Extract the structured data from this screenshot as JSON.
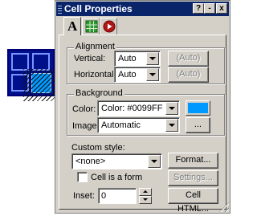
{
  "window": {
    "title": "Cell Properties",
    "help_label": "?",
    "minimize_label": "-",
    "close_label": "x"
  },
  "tabs": [
    {
      "icon": "text-format-icon",
      "glyph": "A"
    },
    {
      "icon": "table-cell-icon"
    },
    {
      "icon": "media-play-icon"
    }
  ],
  "alignment": {
    "group_label": "Alignment",
    "vertical": {
      "label": "Vertical:",
      "value": "Auto",
      "auto_label": "(Auto)"
    },
    "horizontal": {
      "label": "Horizontal:",
      "value": "Auto",
      "auto_label": "(Auto)"
    }
  },
  "background": {
    "group_label": "Background",
    "color": {
      "label": "Color:",
      "value": "Color: #0099FF",
      "swatch": "#0099FF"
    },
    "image": {
      "label": "Image:",
      "value": "Automatic",
      "browse_label": "..."
    }
  },
  "custom_style": {
    "label": "Custom style:",
    "value": "<none>"
  },
  "buttons": {
    "format": "Format...",
    "settings": "Settings...",
    "cell_html": "Cell HTML..."
  },
  "cell_is_form": {
    "label": "Cell is a form",
    "checked": false
  },
  "inset": {
    "label": "Inset:",
    "value": "0"
  },
  "colors": {
    "title_bar": "#0A246A",
    "panel": "#D4D0C8",
    "cell_selected": "#0099FF",
    "table": "#000F8A"
  }
}
